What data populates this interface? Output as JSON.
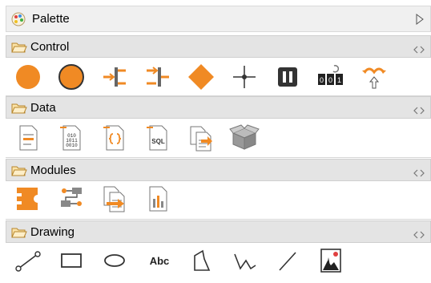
{
  "palette": {
    "title": "Palette",
    "icons": {
      "logo": "palette-logo-icon",
      "collapse": "collapse-triangle-icon"
    }
  },
  "sections": [
    {
      "label": "Control",
      "tools": [
        "start-circle-icon",
        "end-circle-icon",
        "fork-icon",
        "join-icon",
        "decision-diamond-icon",
        "crosshair-icon",
        "pause-icon",
        "counter-icon",
        "loop-arrows-icon"
      ]
    },
    {
      "label": "Data",
      "tools": [
        "text-document-icon",
        "binary-document-icon",
        "json-document-icon",
        "sql-document-icon",
        "merge-document-icon",
        "package-box-icon"
      ]
    },
    {
      "label": "Modules",
      "tools": [
        "module-icon",
        "flowchart-icon",
        "transform-document-icon",
        "report-chart-icon"
      ]
    },
    {
      "label": "Drawing",
      "tools": [
        "connector-line-icon",
        "rectangle-icon",
        "ellipse-icon",
        "text-tool-icon",
        "polygon-icon",
        "polyline-icon",
        "line-icon",
        "image-icon"
      ],
      "text_tool_label": "Abc"
    }
  ],
  "colors": {
    "accent": "#f08a24",
    "header_bg": "#e4e4e4",
    "titlebar_bg": "#f0f0f0"
  }
}
